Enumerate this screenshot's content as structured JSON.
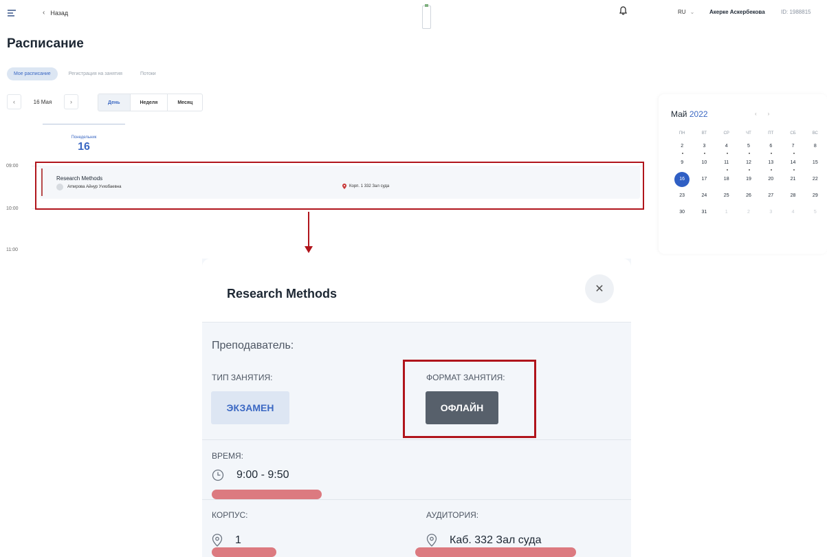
{
  "header": {
    "back_label": "Назад",
    "language": "RU",
    "user_name": "Акерке Аскербекова",
    "user_id": "ID: 1988815"
  },
  "page": {
    "title": "Расписание",
    "tabs": [
      {
        "label": "Мое расписание",
        "active": true
      },
      {
        "label": "Регистрация на занятия",
        "active": false
      },
      {
        "label": "Потоки",
        "active": false
      }
    ]
  },
  "date_nav": {
    "current_date": "16 Мая",
    "views": [
      "День",
      "Неделя",
      "Месяц"
    ],
    "active_view": "День"
  },
  "day_column": {
    "weekday": "Понедельник",
    "day": "16"
  },
  "times": [
    "09:00",
    "10:00",
    "11:00"
  ],
  "event": {
    "title": "Research Methods",
    "teacher": "Аmирова Айнур Уvизбаевна",
    "place": "Корп. 1 332 Зал суда"
  },
  "calendar": {
    "month": "Май",
    "year": "2022",
    "weekdays": [
      "ПН",
      "ВТ",
      "СР",
      "ЧТ",
      "ПТ",
      "СБ",
      "ВС"
    ],
    "weeks": [
      [
        "2",
        "3",
        "4",
        "5",
        "6",
        "7",
        "8"
      ],
      [
        "9",
        "10",
        "11",
        "12",
        "13",
        "14",
        "15"
      ],
      [
        "16",
        "17",
        "18",
        "19",
        "20",
        "21",
        "22"
      ],
      [
        "23",
        "24",
        "25",
        "26",
        "27",
        "28",
        "29"
      ],
      [
        "30",
        "31",
        "1",
        "2",
        "3",
        "4",
        "5"
      ]
    ],
    "selected_day": "16"
  },
  "modal": {
    "title": "Research Methods",
    "teacher_label": "Преподаватель:",
    "type_label": "ТИП ЗАНЯТИЯ:",
    "type_value": "ЭКЗАМЕН",
    "format_label": "ФОРМАТ ЗАНЯТИЯ:",
    "format_value": "ОФЛАЙН",
    "time_label": "ВРЕМЯ:",
    "time_value": "9:00 - 9:50",
    "building_label": "КОРПУС:",
    "building_value": "1",
    "room_label": "АУДИТОРИЯ:",
    "room_value": "Каб. 332 Зал суда"
  },
  "colors": {
    "accent": "#3b68c3",
    "highlight": "#b0141b",
    "offline_badge": "#57606b"
  }
}
